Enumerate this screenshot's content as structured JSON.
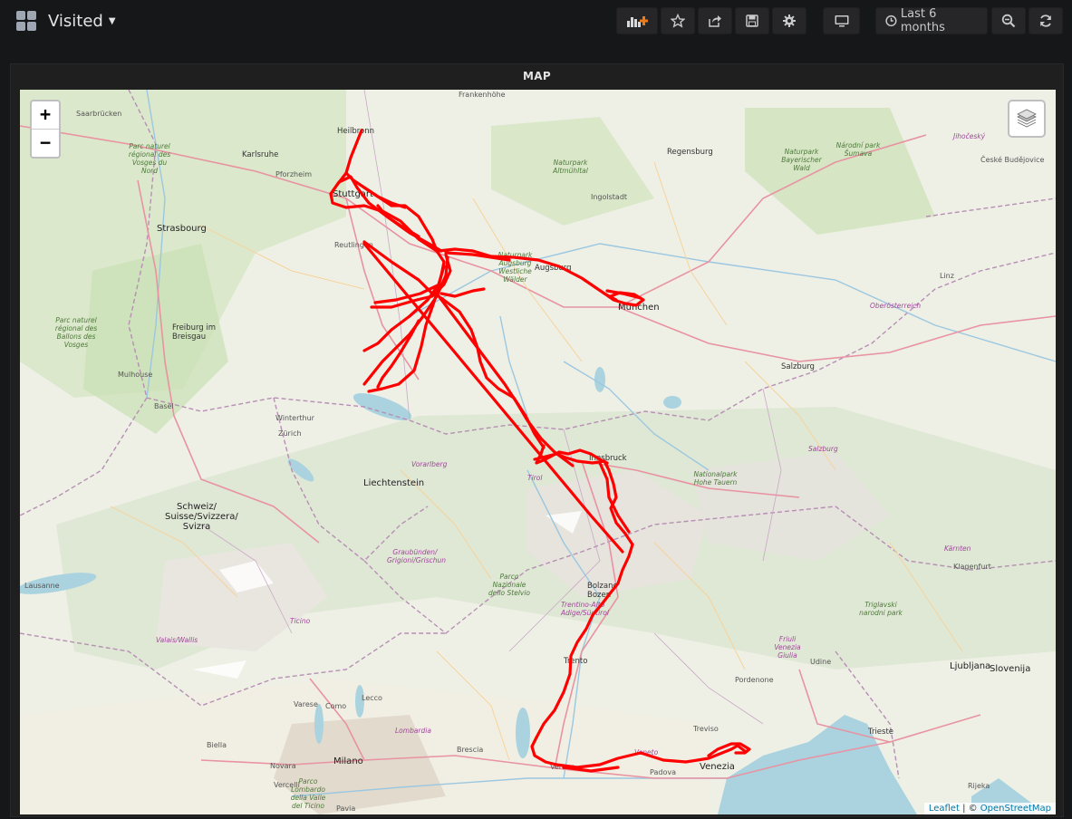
{
  "dashboard": {
    "title": "Visited"
  },
  "toolbar": {
    "time_range_label": "Last 6 months"
  },
  "panel": {
    "title": "MAP"
  },
  "map": {
    "zoom_in_label": "+",
    "zoom_out_label": "−",
    "attribution_link1": "Leaflet",
    "attribution_sep": " | © ",
    "attribution_link2": "OpenStreetMap",
    "track_color": "#ff0000",
    "labels": [
      {
        "t": "Frankenhöhe",
        "c": "lbl"
      },
      {
        "t": "Saarbrücken",
        "c": "lbl"
      },
      {
        "t": "Heilbronn",
        "c": "lbl city"
      },
      {
        "t": "Karlsruhe",
        "c": "lbl city"
      },
      {
        "t": "Pforzheim",
        "c": "lbl"
      },
      {
        "t": "Stuttgart",
        "c": "lbl big"
      },
      {
        "t": "Reutlingen",
        "c": "lbl"
      },
      {
        "t": "Strasbourg",
        "c": "lbl big"
      },
      {
        "t": "Freiburg im Breisgau",
        "c": "lbl city"
      },
      {
        "t": "Mulhouse",
        "c": "lbl"
      },
      {
        "t": "Basel",
        "c": "lbl"
      },
      {
        "t": "Winterthur",
        "c": "lbl"
      },
      {
        "t": "Zürich",
        "c": "lbl"
      },
      {
        "t": "Liechtenstein",
        "c": "lbl big"
      },
      {
        "t": "Schweiz/ Suisse/Svizzera/ Svizra",
        "c": "lbl big"
      },
      {
        "t": "Lausanne",
        "c": "lbl"
      },
      {
        "t": "Regensburg",
        "c": "lbl city"
      },
      {
        "t": "Ingolstadt",
        "c": "lbl"
      },
      {
        "t": "Augsburg",
        "c": "lbl city"
      },
      {
        "t": "München",
        "c": "lbl big"
      },
      {
        "t": "Salzburg",
        "c": "lbl city"
      },
      {
        "t": "Linz",
        "c": "lbl"
      },
      {
        "t": "Innsbruck",
        "c": "lbl city"
      },
      {
        "t": "Tirol",
        "c": "lbl region"
      },
      {
        "t": "Vorarlberg",
        "c": "lbl region"
      },
      {
        "t": "Bolzano Bozen",
        "c": "lbl city"
      },
      {
        "t": "Trentino-Alto Adige/Südtirol",
        "c": "lbl region"
      },
      {
        "t": "Trento",
        "c": "lbl city"
      },
      {
        "t": "Varese",
        "c": "lbl"
      },
      {
        "t": "Como",
        "c": "lbl"
      },
      {
        "t": "Lecco",
        "c": "lbl"
      },
      {
        "t": "Milano",
        "c": "lbl big"
      },
      {
        "t": "Brescia",
        "c": "lbl"
      },
      {
        "t": "Verona",
        "c": "lbl"
      },
      {
        "t": "Padova",
        "c": "lbl"
      },
      {
        "t": "Venezia",
        "c": "lbl big"
      },
      {
        "t": "Treviso",
        "c": "lbl"
      },
      {
        "t": "Pordenone",
        "c": "lbl"
      },
      {
        "t": "Udine",
        "c": "lbl"
      },
      {
        "t": "Trieste",
        "c": "lbl city"
      },
      {
        "t": "Ljubljana",
        "c": "lbl big"
      },
      {
        "t": "Slovenija",
        "c": "lbl big"
      },
      {
        "t": "Klagenfurt",
        "c": "lbl"
      },
      {
        "t": "Kärnten",
        "c": "lbl region"
      },
      {
        "t": "Salzburg",
        "c": "lbl region"
      },
      {
        "t": "Oberösterreich",
        "c": "lbl region"
      },
      {
        "t": "Jihočeský",
        "c": "lbl region"
      },
      {
        "t": "České Budějovice",
        "c": "lbl"
      },
      {
        "t": "Rijeka",
        "c": "lbl"
      },
      {
        "t": "Pavia",
        "c": "lbl"
      },
      {
        "t": "Novara",
        "c": "lbl"
      },
      {
        "t": "Vercelli",
        "c": "lbl"
      },
      {
        "t": "Biella",
        "c": "lbl"
      },
      {
        "t": "Lombardia",
        "c": "lbl region"
      },
      {
        "t": "Veneto",
        "c": "lbl region"
      },
      {
        "t": "Friuli Venezia Giulia",
        "c": "lbl region"
      },
      {
        "t": "Ticino",
        "c": "lbl region"
      },
      {
        "t": "Valais/Wallis",
        "c": "lbl region"
      },
      {
        "t": "Graubünden/ Grigioni/Grischun",
        "c": "lbl region"
      },
      {
        "t": "Naturpark Altmühltal",
        "c": "lbl park"
      },
      {
        "t": "Naturpark Bayerischer Wald",
        "c": "lbl park"
      },
      {
        "t": "Naturpark Augsburg Westliche Wälder",
        "c": "lbl park"
      },
      {
        "t": "Parc naturel régional des Ballons des Vosges",
        "c": "lbl park"
      },
      {
        "t": "Parc naturel régional des Vosges du Nord",
        "c": "lbl park"
      },
      {
        "t": "Nationalpark Hohe Tauern",
        "c": "lbl park"
      },
      {
        "t": "Parco Nazionale dello Stelvio",
        "c": "lbl park"
      },
      {
        "t": "Triglavski narodni park",
        "c": "lbl park"
      },
      {
        "t": "Národní park Šumava",
        "c": "lbl park"
      },
      {
        "t": "Parco Lombardo della Valle del Ticino",
        "c": "lbl park"
      }
    ]
  }
}
